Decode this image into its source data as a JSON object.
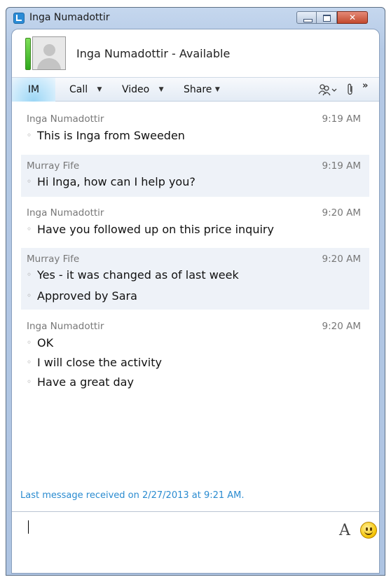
{
  "window": {
    "title": "Inga Numadottir"
  },
  "contact": {
    "display": "Inga Numadottir - Available",
    "presence_color": "#3cb828"
  },
  "toolbar": {
    "im": "IM",
    "call": "Call",
    "video": "Video",
    "share": "Share",
    "icons": [
      "people-icon",
      "paperclip-icon",
      "more-options-icon"
    ]
  },
  "conversation": [
    {
      "sender": "Inga Numadottir",
      "time": "9:19 AM",
      "lines": [
        "This is Inga from Sweeden"
      ]
    },
    {
      "sender": "Murray Fife",
      "time": "9:19 AM",
      "lines": [
        "Hi Inga, how can I help you?"
      ]
    },
    {
      "sender": "Inga Numadottir",
      "time": "9:20 AM",
      "lines": [
        "Have you followed up on this price inquiry"
      ]
    },
    {
      "sender": "Murray Fife",
      "time": "9:20 AM",
      "lines": [
        "Yes - it was changed as of last week",
        "Approved by Sara"
      ]
    },
    {
      "sender": "Inga Numadottir",
      "time": "9:20 AM",
      "lines": [
        "OK",
        "I will close the activity",
        "Have a great day"
      ]
    }
  ],
  "status": {
    "last_received": "Last message received on 2/27/2013 at 9:21 AM."
  },
  "compose": {
    "font_label": "A",
    "value": ""
  },
  "colors": {
    "accent": "#2a8bd0",
    "alt_row": "#eef2f8"
  }
}
